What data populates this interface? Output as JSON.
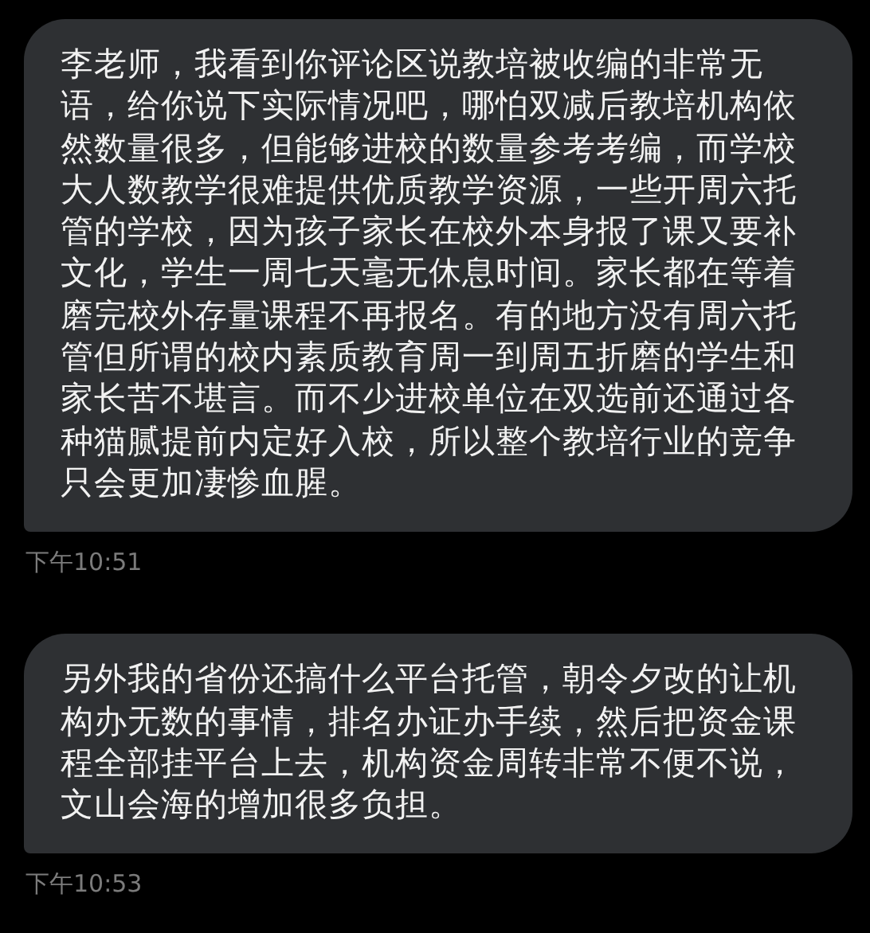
{
  "messages": [
    {
      "text": "李老师，我看到你评论区说教培被收编的非常无语，给你说下实际情况吧，哪怕双减后教培机构依然数量很多，但能够进校的数量参考考编，而学校大人数教学很难提供优质教学资源，一些开周六托管的学校，因为孩子家长在校外本身报了课又要补文化，学生一周七天毫无休息时间。家长都在等着磨完校外存量课程不再报名。有的地方没有周六托管但所谓的校内素质教育周一到周五折磨的学生和家长苦不堪言。而不少进校单位在双选前还通过各种猫腻提前内定好入校，所以整个教培行业的竞争只会更加凄惨血腥。",
      "time": "下午10:51"
    },
    {
      "text": "另外我的省份还搞什么平台托管，朝令夕改的让机构办无数的事情，排名办证办手续，然后把资金课程全部挂平台上去，机构资金周转非常不便不说，文山会海的增加很多负担。",
      "time": "下午10:53"
    }
  ]
}
